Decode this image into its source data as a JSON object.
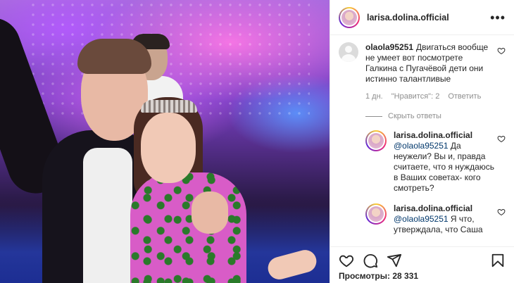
{
  "header": {
    "username": "larisa.dolina.official",
    "more_icon": "more-horizontal-icon"
  },
  "comments": [
    {
      "username": "olaola95251",
      "text": "Двигаться вообще не умеет вот посмотрете Галкина с Пугачёвой дети они истинно талантливые",
      "time": "1 дн.",
      "likes": "\"Нравится\": 2",
      "reply_label": "Ответить",
      "hide_replies_label": "Скрыть ответы"
    }
  ],
  "replies": [
    {
      "username": "larisa.dolina.official",
      "mention": "@olaola95251",
      "text": "Да неужели? Вы и, правда считаете, что я нуждаюсь в Ваших советах- кого смотреть?"
    },
    {
      "username": "larisa.dolina.official",
      "mention": "@olaola95251",
      "text": "Я что, утверждала, что Саша"
    }
  ],
  "footer": {
    "views_label": "Просмотры: 28 331",
    "icons": [
      "heart-icon",
      "comment-icon",
      "share-icon",
      "bookmark-icon"
    ]
  }
}
